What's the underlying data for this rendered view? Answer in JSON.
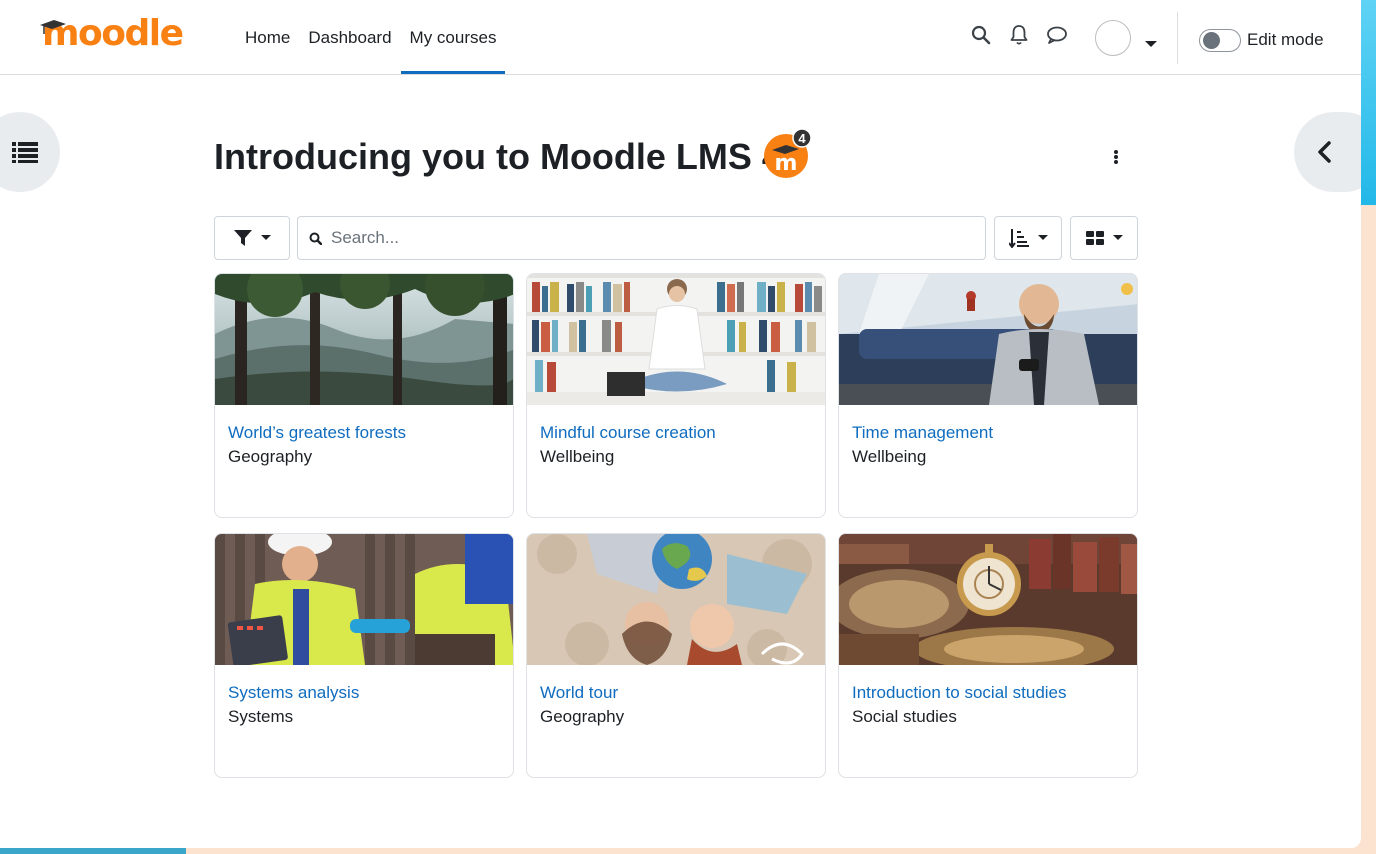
{
  "brand": {
    "logo_text": "moodle"
  },
  "nav": {
    "links": [
      "Home",
      "Dashboard",
      "My courses"
    ],
    "active": "My courses"
  },
  "header": {
    "edit_mode_label": "Edit mode",
    "edit_mode_on": false
  },
  "page": {
    "title": "Introducing you to Moodle LMS 4",
    "badge_number": "4"
  },
  "toolbar": {
    "search_placeholder": "Search..."
  },
  "courses": [
    {
      "title": "World’s greatest forests",
      "category": "Geography"
    },
    {
      "title": "Mindful course creation",
      "category": "Wellbeing"
    },
    {
      "title": "Time management",
      "category": "Wellbeing"
    },
    {
      "title": "Systems analysis",
      "category": "Systems"
    },
    {
      "title": "World tour",
      "category": "Geography"
    },
    {
      "title": "Introduction to social studies",
      "category": "Social studies"
    }
  ],
  "colors": {
    "brand_orange": "#f98012",
    "link_blue": "#0f6cbf",
    "text_dark": "#1d2125"
  },
  "icons": [
    "search-icon",
    "bell-icon",
    "chat-icon",
    "filter-icon",
    "sort-icon",
    "grid-view-icon",
    "course-index-icon",
    "chevron-left-icon",
    "kebab-icon"
  ]
}
